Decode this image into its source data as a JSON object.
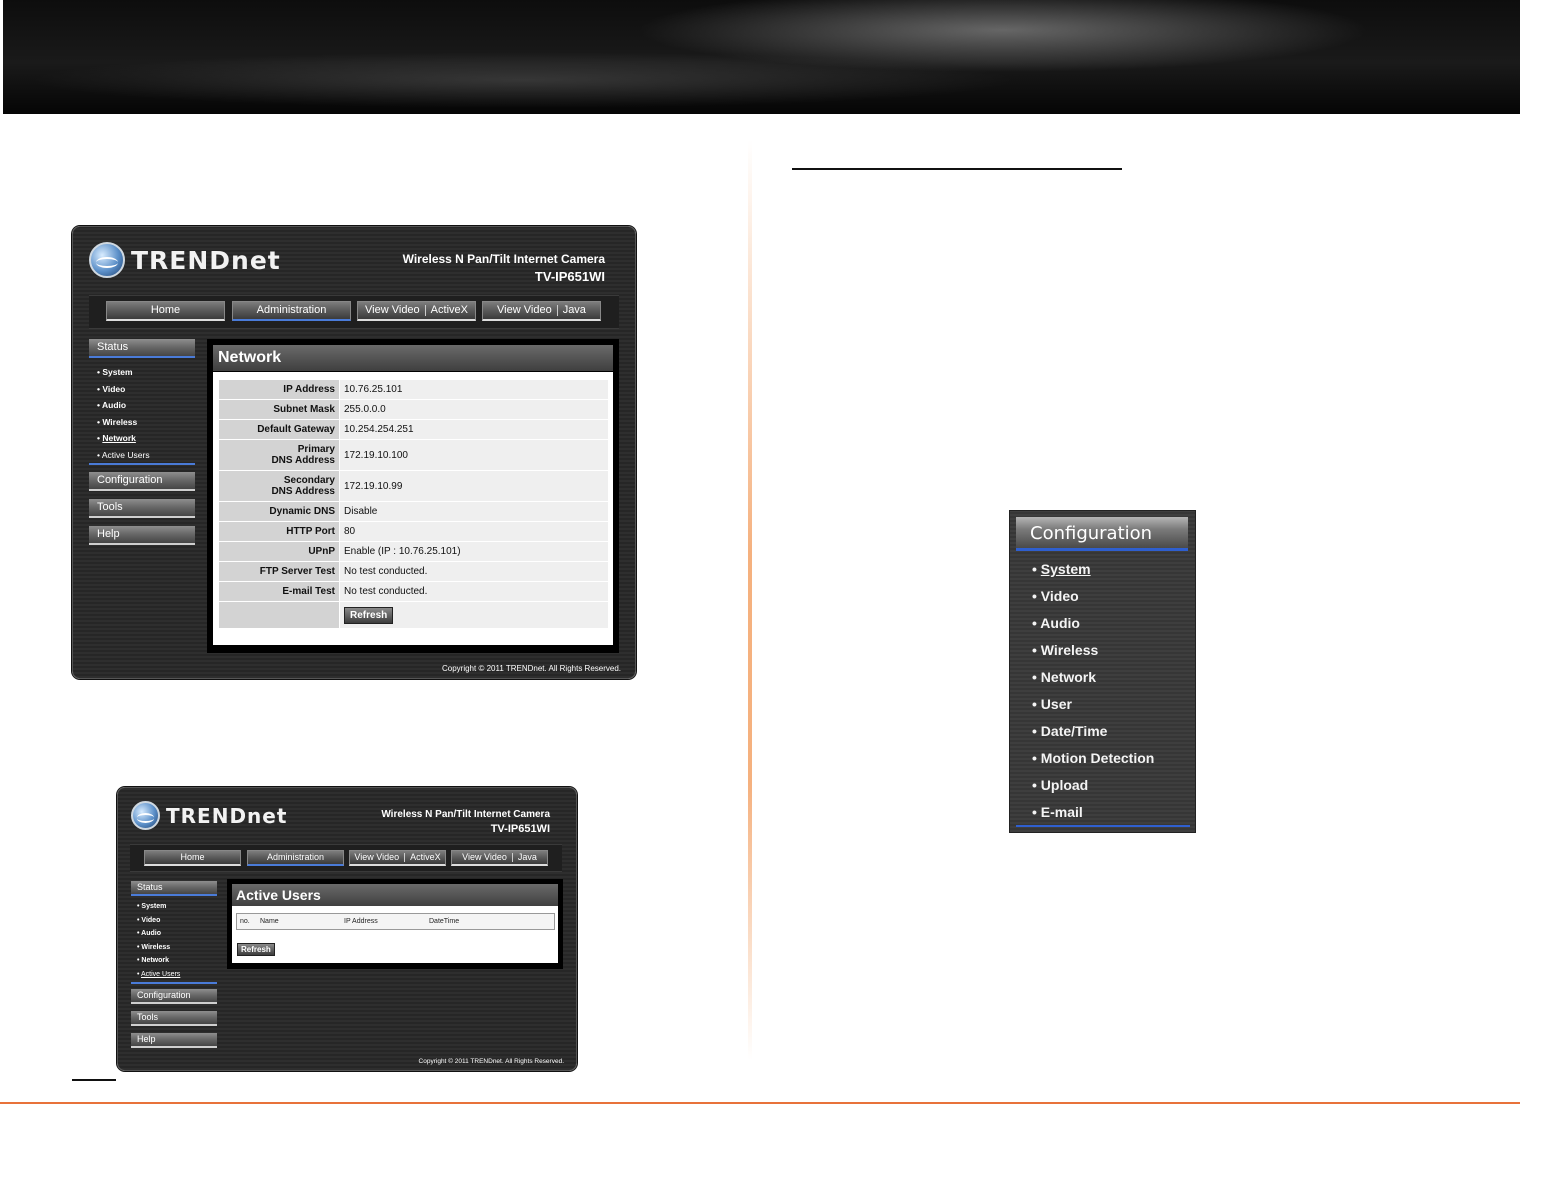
{
  "brand": "TRENDnet",
  "product": {
    "line1": "Wireless N Pan/Tilt Internet Camera",
    "line2": "TV-IP651WI"
  },
  "nav": {
    "home": "Home",
    "administration": "Administration",
    "view_video_activex": [
      "View Video",
      "ActiveX"
    ],
    "view_video_java": [
      "View Video",
      "Java"
    ]
  },
  "sidebar": {
    "status": "Status",
    "status_items": [
      "System",
      "Video",
      "Audio",
      "Wireless",
      "Network",
      "Active Users"
    ],
    "configuration": "Configuration",
    "tools": "Tools",
    "help": "Help"
  },
  "network_page": {
    "title": "Network",
    "rows": [
      {
        "label": "IP Address",
        "value": "10.76.25.101"
      },
      {
        "label": "Subnet Mask",
        "value": "255.0.0.0"
      },
      {
        "label": "Default Gateway",
        "value": "10.254.254.251"
      },
      {
        "label": "Primary DNS Address",
        "label_line1": "Primary",
        "label_line2": "DNS Address",
        "value": "172.19.10.100"
      },
      {
        "label": "Secondary DNS Address",
        "label_line1": "Secondary",
        "label_line2": "DNS Address",
        "value": "172.19.10.99"
      },
      {
        "label": "Dynamic DNS",
        "value": "Disable"
      },
      {
        "label": "HTTP Port",
        "value": "80"
      },
      {
        "label": "UPnP",
        "value": "Enable (IP : 10.76.25.101)"
      },
      {
        "label": "FTP Server Test",
        "value": "No test conducted."
      },
      {
        "label": "E-mail Test",
        "value": "No test conducted."
      }
    ],
    "refresh": "Refresh"
  },
  "active_users_page": {
    "title": "Active Users",
    "columns": [
      "no.",
      "Name",
      "IP Address",
      "DateTime"
    ],
    "refresh": "Refresh"
  },
  "copyright": "Copyright © 2011 TRENDnet. All Rights Reserved.",
  "config_menu": {
    "title": "Configuration",
    "items": [
      "System",
      "Video",
      "Audio",
      "Wireless",
      "Network",
      "User",
      "Date/Time",
      "Motion Detection",
      "Upload",
      "E-mail"
    ]
  },
  "colors": {
    "accent_line": "#e8723a",
    "nav_active": "#4a7bd8"
  }
}
